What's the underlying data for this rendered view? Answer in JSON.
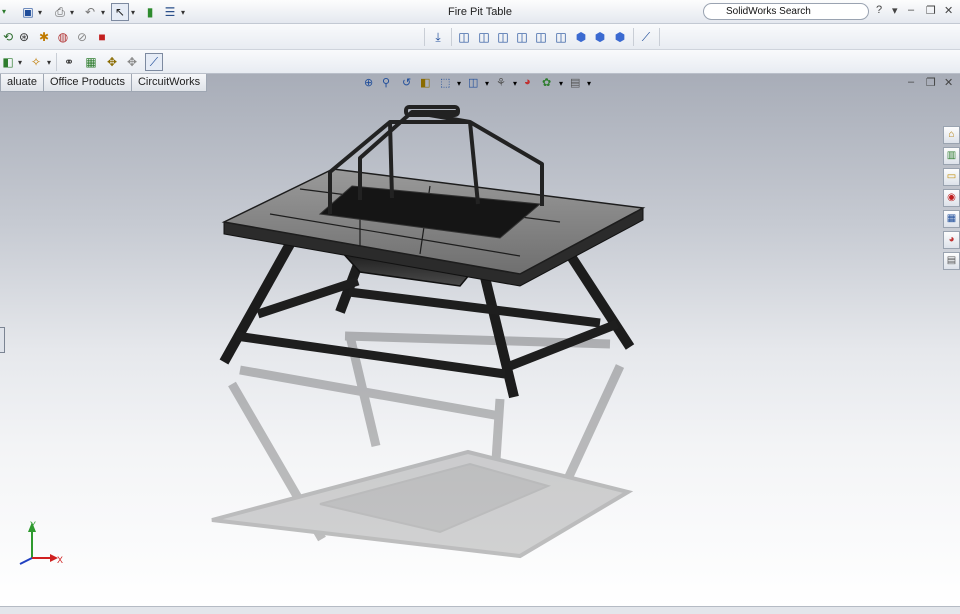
{
  "window": {
    "title": "Fire Pit Table"
  },
  "search": {
    "value": "SolidWorks Search"
  },
  "tabs": [
    "aluate",
    "Office Products",
    "CircuitWorks"
  ],
  "triad": {
    "x_label": "X",
    "y_label": "Y"
  },
  "colors": {
    "accent": "#2b4b7e",
    "viewport_top": "#a8adb8",
    "viewport_bottom": "#ffffff",
    "model": "#2a2a2a"
  },
  "icons": {
    "quick_access": [
      "open-icon",
      "save-icon",
      "print-icon",
      "undo-icon",
      "select-icon",
      "rebuild-icon",
      "options-icon"
    ],
    "standard_views": [
      "front-view-icon",
      "back-view-icon",
      "left-view-icon",
      "right-view-icon",
      "top-view-icon",
      "bottom-view-icon",
      "isometric-view-icon",
      "trimetric-view-icon",
      "dimetric-view-icon"
    ]
  }
}
